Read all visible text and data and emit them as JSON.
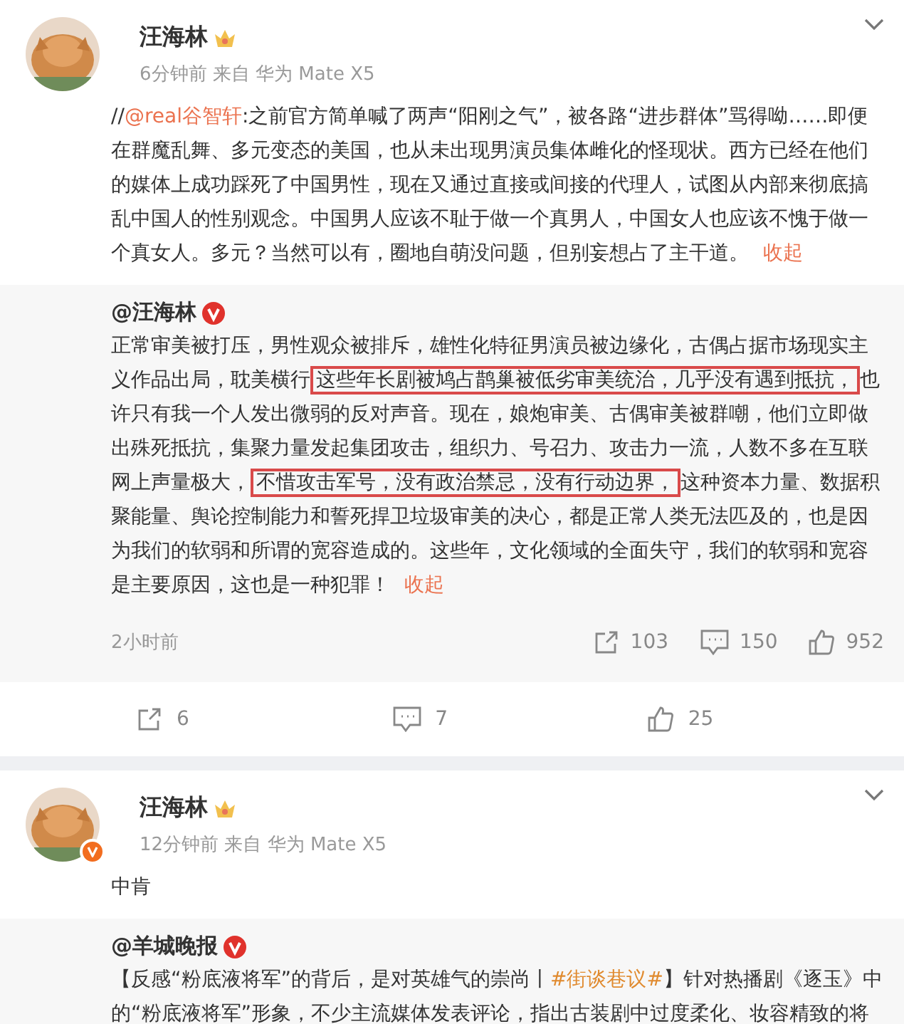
{
  "posts": [
    {
      "author": "汪海林",
      "meta": "6分钟前 来自 华为 Mate X5",
      "text": [
        {
          "kind": "text",
          "text": "//"
        },
        {
          "kind": "mention",
          "text": "@real谷智轩"
        },
        {
          "kind": "text",
          "text": ":之前官方简单喊了两声“阳刚之气”，被各路“进步群体”骂得呦……即便在群魔乱舞、多元变态的美国，也从未出现男演员集体雌化的怪现状。西方已经在他们的媒体上成功踩死了中国男性，现在又通过直接或间接的代理人，试图从内部来彻底搞乱中国人的性别观念。中国男人应该不耻于做一个真男人，中国女人也应该不愧于做一个真女人。多元？当然可以有，圈地自萌没问题，但别妄想占了主干道。"
        }
      ],
      "collapse": "收起",
      "repost": {
        "author": "@汪海林",
        "text": [
          {
            "kind": "text",
            "text": "正常审美被打压，男性观众被排斥，雄性化特征男演员被边缘化，古偶占据市场现实主义作品出局，耽美横行"
          },
          {
            "kind": "highlight",
            "text": "这些年长剧被鸠占鹊巢被低劣审美统治，几乎没有遇到抵抗，"
          },
          {
            "kind": "text",
            "text": "也许只有我一个人发出微弱的反对声音。现在，娘炮审美、古偶审美被群嘲，他们立即做出殊死抵抗，集聚力量发起集团攻击，组织力、号召力、攻击力一流，人数不多在互联网上声量极大，"
          },
          {
            "kind": "highlight",
            "text": "不惜攻击军号，没有政治禁忌，没有行动边界，"
          },
          {
            "kind": "text",
            "text": "这种资本力量、数据积聚能量、舆论控制能力和誓死捍卫垃圾审美的决心，都是正常人类无法匹及的，也是因为我们的软弱和所谓的宽容造成的。这些年，文化领域的全面失守，我们的软弱和宽容是主要原因，这也是一种犯罪！"
          }
        ],
        "collapse": "收起",
        "time": "2小时前",
        "reposts": "103",
        "comments": "150",
        "likes": "952"
      },
      "reposts": "6",
      "comments": "7",
      "likes": "25"
    },
    {
      "author": "汪海林",
      "meta": "12分钟前 来自 华为 Mate X5",
      "verified": true,
      "text": [
        {
          "kind": "text",
          "text": "中肯"
        }
      ],
      "repost": {
        "author": "@羊城晚报",
        "text": [
          {
            "kind": "text",
            "text": "【反感“粉底液将军”的背后，是对英雄气的崇尚丨"
          },
          {
            "kind": "hashtag",
            "text": "#街谈巷议#"
          },
          {
            "kind": "text",
            "text": "】针对热播剧《逐玉》中的“粉底液将军”形象，不少主流媒体发表评论，指出古装剧中过度柔化、妆容精致的将"
          }
        ]
      }
    }
  ]
}
